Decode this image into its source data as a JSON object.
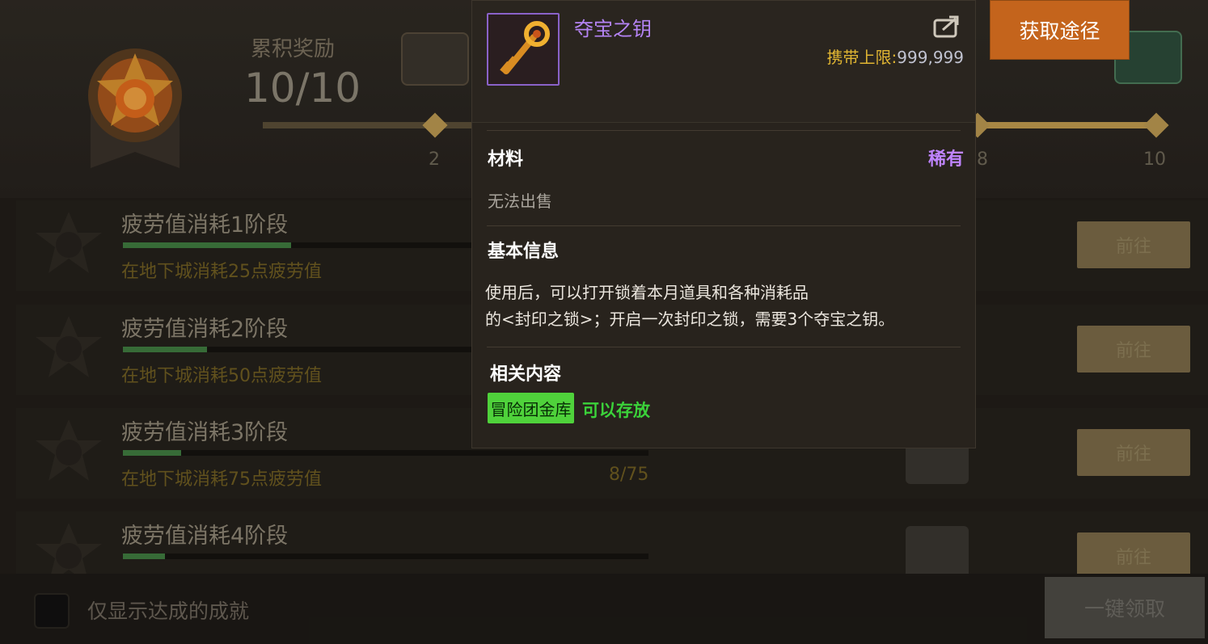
{
  "header": {
    "cumulative_label": "累积奖励",
    "cumulative_value": "10/10",
    "milestones": [
      {
        "label": "2",
        "reached": true
      },
      {
        "label": "8",
        "reached": true
      },
      {
        "label": "10",
        "reached": true
      }
    ]
  },
  "achievements": [
    {
      "title": "疲劳值消耗1阶段",
      "desc": "在地下城消耗25点疲劳值",
      "count": "",
      "progress": 0.32,
      "button": "前往"
    },
    {
      "title": "疲劳值消耗2阶段",
      "desc": "在地下城消耗50点疲劳值",
      "count": "",
      "progress": 0.16,
      "button": "前往"
    },
    {
      "title": "疲劳值消耗3阶段",
      "desc": "在地下城消耗75点疲劳值",
      "count": "8/75",
      "progress": 0.11,
      "button": "前往"
    },
    {
      "title": "疲劳值消耗4阶段",
      "desc": "",
      "count": "",
      "progress": 0.08,
      "button": "前往"
    }
  ],
  "footer": {
    "checkbox_label": "仅显示达成的成就",
    "claim_all": "一键领取"
  },
  "popup": {
    "item_name": "夺宝之钥",
    "carry_label": "携带上限:",
    "carry_value": "999,999",
    "category": "材料",
    "rarity": "稀有",
    "sell_status": "无法出售",
    "basic_info_title": "基本信息",
    "description_line1": "使用后，可以打开锁着本月道具和各种消耗品",
    "description_line2": "的<封印之锁>；开启一次封印之锁，需要3个夺宝之钥。",
    "related_title": "相关内容",
    "related_tag": "冒险团金库",
    "related_note": "可以存放",
    "acquire_button": "获取途径"
  },
  "colors": {
    "item_name": "#b584f5",
    "rarity": "#bf84ff",
    "carry_label": "#e0b532",
    "tag_bg": "#4fd23b",
    "acquire_bg": "#c4641c"
  },
  "icons": [
    "medal-icon",
    "chest-icon",
    "key-icon",
    "share-icon",
    "emblem-icon"
  ]
}
